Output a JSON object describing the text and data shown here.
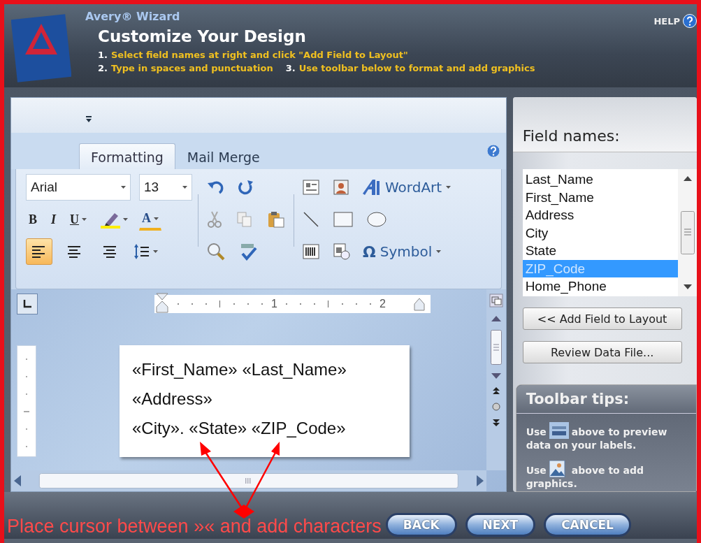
{
  "header": {
    "product": "Avery® Wizard",
    "title": "Customize Your Design",
    "steps": [
      {
        "number": "1.",
        "text": "Select field names at right and click \"Add Field to Layout\""
      },
      {
        "number": "2.",
        "text": "Type in spaces and punctuation"
      },
      {
        "number": "3.",
        "text": "Use toolbar below to format and add graphics"
      }
    ],
    "help": "HELP"
  },
  "ribbon": {
    "tabs": [
      {
        "label": "Formatting",
        "selected": true
      },
      {
        "label": "Mail Merge",
        "selected": false
      }
    ],
    "font": "Arial",
    "size": "13",
    "style_buttons": [
      "B",
      "I",
      "U"
    ],
    "font_color": "A",
    "alignment": [
      {
        "kind": "left",
        "selected": true
      },
      {
        "kind": "center",
        "selected": false
      },
      {
        "kind": "right",
        "selected": false
      }
    ],
    "wordart": "WordArt",
    "symbol_glyph": "Ω",
    "symbol": "Symbol"
  },
  "document": {
    "ruler_marks": [
      "1",
      "2"
    ],
    "lines": [
      "«First_Name» «Last_Name»",
      "«Address»",
      "«City». «State» «ZIP_Code»"
    ]
  },
  "fields": {
    "heading": "Field names:",
    "items": [
      {
        "label": "Last_Name",
        "selected": false
      },
      {
        "label": "First_Name",
        "selected": false
      },
      {
        "label": "Address",
        "selected": false
      },
      {
        "label": "City",
        "selected": false
      },
      {
        "label": "State",
        "selected": false
      },
      {
        "label": "ZIP_Code",
        "selected": true
      },
      {
        "label": "Home_Phone",
        "selected": false
      }
    ],
    "buttons": [
      "<< Add Field to Layout",
      "Review Data File..."
    ]
  },
  "tips": {
    "heading": "Toolbar tips:",
    "items": [
      {
        "kind": "preview",
        "before": "Use",
        "after": "above to preview",
        "continued": "data on your labels."
      },
      {
        "kind": "picture",
        "before": "Use",
        "after": "above to add",
        "continued": "graphics."
      }
    ]
  },
  "annotation": "Place cursor between »« and add characters",
  "nav_buttons": [
    "BACK",
    "NEXT",
    "CANCEL"
  ]
}
